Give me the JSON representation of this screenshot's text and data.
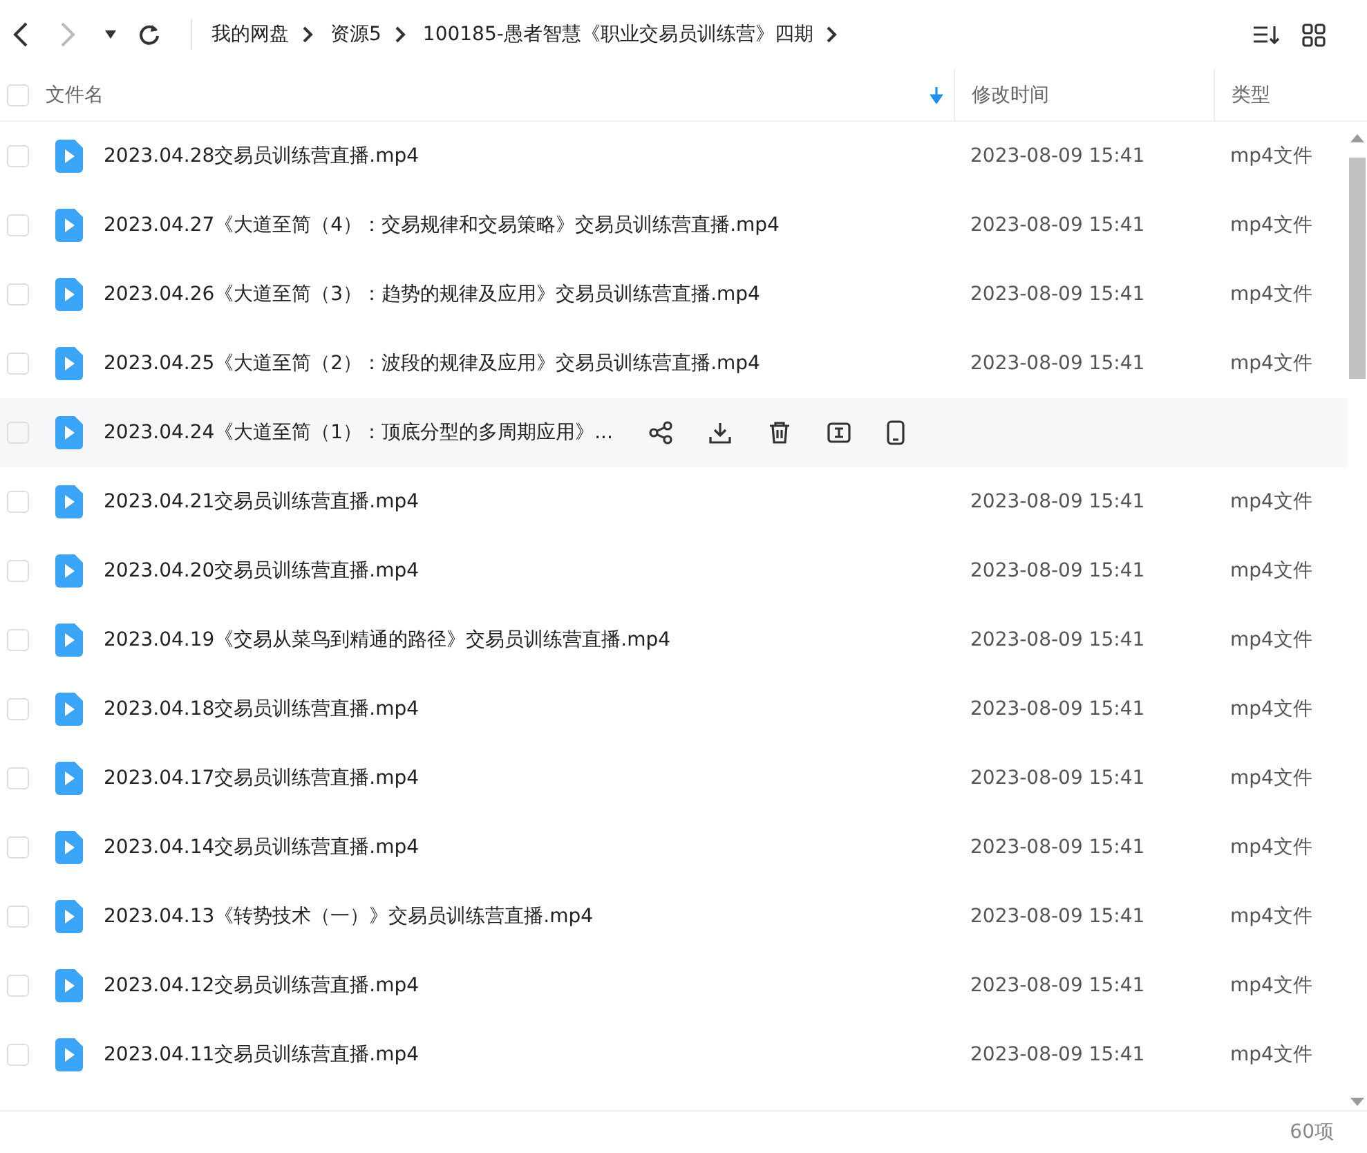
{
  "toolbar": {
    "breadcrumb": [
      "我的网盘",
      "资源5",
      "100185-愚者智慧《职业交易员训练营》四期"
    ]
  },
  "table": {
    "all_checked": false,
    "columns": [
      {
        "label": "文件名",
        "sorted": true
      },
      {
        "label": "修改时间",
        "sorted": false
      },
      {
        "label": "类型",
        "sorted": false
      }
    ],
    "rows": [
      {
        "name": "2023.04.28交易员训练营直播.mp4",
        "modified": "2023-08-09 15:41",
        "type": "mp4文件",
        "hovered": false,
        "checked": false
      },
      {
        "name": "2023.04.27《大道至简（4）：交易规律和交易策略》交易员训练营直播.mp4",
        "modified": "2023-08-09 15:41",
        "type": "mp4文件",
        "hovered": false,
        "checked": false
      },
      {
        "name": "2023.04.26《大道至简（3）：趋势的规律及应用》交易员训练营直播.mp4",
        "modified": "2023-08-09 15:41",
        "type": "mp4文件",
        "hovered": false,
        "checked": false
      },
      {
        "name": "2023.04.25《大道至简（2）：波段的规律及应用》交易员训练营直播.mp4",
        "modified": "2023-08-09 15:41",
        "type": "mp4文件",
        "hovered": false,
        "checked": false
      },
      {
        "name": "2023.04.24《大道至简（1）：顶底分型的多周期应用》...",
        "hovered": true,
        "checked": false
      },
      {
        "name": "2023.04.21交易员训练营直播.mp4",
        "modified": "2023-08-09 15:41",
        "type": "mp4文件",
        "hovered": false,
        "checked": false
      },
      {
        "name": "2023.04.20交易员训练营直播.mp4",
        "modified": "2023-08-09 15:41",
        "type": "mp4文件",
        "hovered": false,
        "checked": false
      },
      {
        "name": "2023.04.19《交易从菜鸟到精通的路径》交易员训练营直播.mp4",
        "modified": "2023-08-09 15:41",
        "type": "mp4文件",
        "hovered": false,
        "checked": false
      },
      {
        "name": "2023.04.18交易员训练营直播.mp4",
        "modified": "2023-08-09 15:41",
        "type": "mp4文件",
        "hovered": false,
        "checked": false
      },
      {
        "name": "2023.04.17交易员训练营直播.mp4",
        "modified": "2023-08-09 15:41",
        "type": "mp4文件",
        "hovered": false,
        "checked": false
      },
      {
        "name": "2023.04.14交易员训练营直播.mp4",
        "modified": "2023-08-09 15:41",
        "type": "mp4文件",
        "hovered": false,
        "checked": false
      },
      {
        "name": "2023.04.13《转势技术（一）》交易员训练营直播.mp4",
        "modified": "2023-08-09 15:41",
        "type": "mp4文件",
        "hovered": false,
        "checked": false
      },
      {
        "name": "2023.04.12交易员训练营直播.mp4",
        "modified": "2023-08-09 15:41",
        "type": "mp4文件",
        "hovered": false,
        "checked": false
      },
      {
        "name": "2023.04.11交易员训练营直播.mp4",
        "modified": "2023-08-09 15:41",
        "type": "mp4文件",
        "hovered": false,
        "checked": false
      }
    ]
  },
  "status_bar": {
    "count": "60项"
  }
}
